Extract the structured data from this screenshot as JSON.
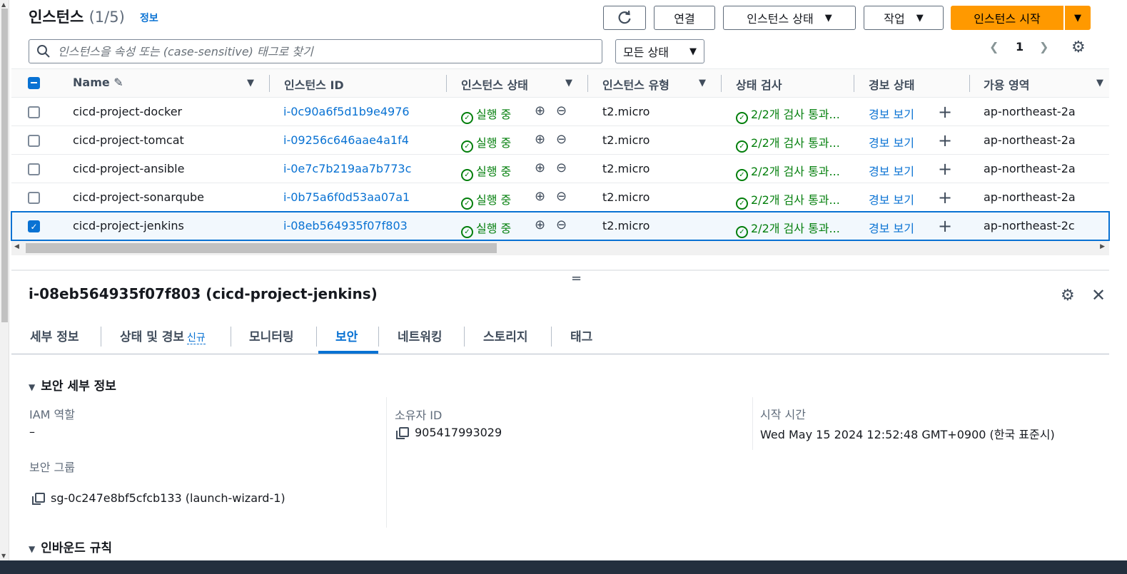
{
  "header": {
    "title": "인스턴스",
    "count": "(1/5)",
    "info_link": "정보"
  },
  "toolbar": {
    "connect_label": "연결",
    "instance_state_label": "인스턴스 상태",
    "actions_label": "작업",
    "launch_label": "인스턴스 시작"
  },
  "search": {
    "placeholder": "인스턴스을 속성 또는 (case-sensitive) 태그로 찾기"
  },
  "filter": {
    "state_selected": "모든 상태"
  },
  "pagination": {
    "page": "1"
  },
  "table": {
    "columns": [
      "Name",
      "인스턴스 ID",
      "인스턴스 상태",
      "인스턴스 유형",
      "상태 검사",
      "경보 상태",
      "가용 영역"
    ],
    "rows": [
      {
        "name": "cicd-project-docker",
        "id": "i-0c90a6f5d1b9e4976",
        "state": "실행 중",
        "type": "t2.micro",
        "check": "2/2개 검사 통과...",
        "alarm": "경보 보기",
        "az": "ap-northeast-2a",
        "selected": false
      },
      {
        "name": "cicd-project-tomcat",
        "id": "i-09256c646aae4a1f4",
        "state": "실행 중",
        "type": "t2.micro",
        "check": "2/2개 검사 통과...",
        "alarm": "경보 보기",
        "az": "ap-northeast-2a",
        "selected": false
      },
      {
        "name": "cicd-project-ansible",
        "id": "i-0e7c7b219aa7b773c",
        "state": "실행 중",
        "type": "t2.micro",
        "check": "2/2개 검사 통과...",
        "alarm": "경보 보기",
        "az": "ap-northeast-2a",
        "selected": false
      },
      {
        "name": "cicd-project-sonarqube",
        "id": "i-0b75a6f0d53aa07a1",
        "state": "실행 중",
        "type": "t2.micro",
        "check": "2/2개 검사 통과...",
        "alarm": "경보 보기",
        "az": "ap-northeast-2a",
        "selected": false
      },
      {
        "name": "cicd-project-jenkins",
        "id": "i-08eb564935f07f803",
        "state": "실행 중",
        "type": "t2.micro",
        "check": "2/2개 검사 통과...",
        "alarm": "경보 보기",
        "az": "ap-northeast-2c",
        "selected": true
      }
    ]
  },
  "detail": {
    "title": "i-08eb564935f07f803 (cicd-project-jenkins)",
    "tabs": [
      "세부 정보",
      "상태 및 경보",
      "모니터링",
      "보안",
      "네트워킹",
      "스토리지",
      "태그"
    ],
    "new_badge": "신규",
    "active_tab": "보안",
    "security_section": "보안 세부 정보",
    "iam_label": "IAM 역할",
    "iam_value": "–",
    "owner_label": "소유자 ID",
    "owner_value": "905417993029",
    "launch_label": "시작 시간",
    "launch_value": "Wed May 15 2024 12:52:48 GMT+0900 (한국 표준시)",
    "sg_label": "보안 그룹",
    "sg_value": "sg-0c247e8bf5cfcb133 (launch-wizard-1)",
    "inbound_section": "인바운드 규칙"
  },
  "colors": {
    "primary": "#ff9900",
    "link": "#0972d3",
    "success": "#037f0c",
    "footer": "#232f3e"
  }
}
